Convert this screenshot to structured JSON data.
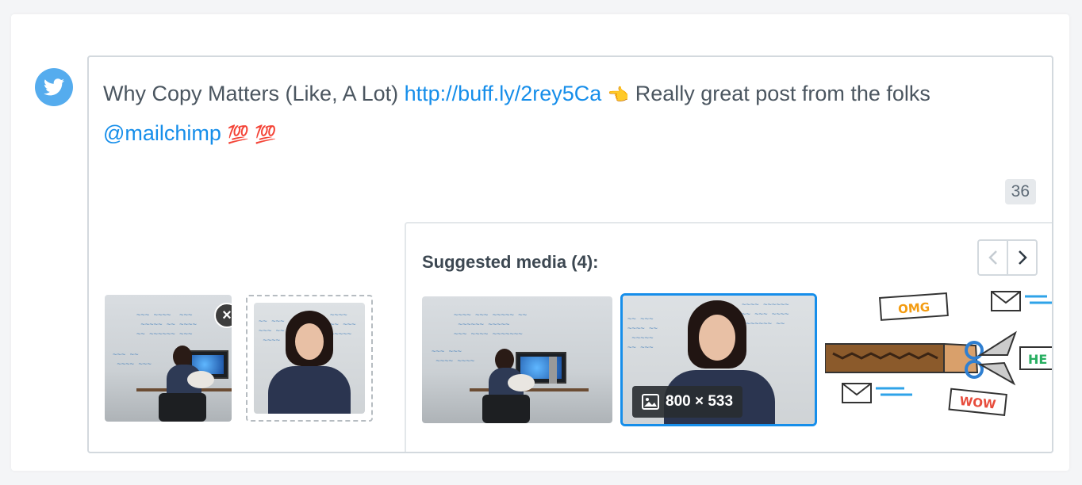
{
  "post": {
    "text_start": "Why Copy Matters (Like, A Lot) ",
    "link": "http://buff.ly/2rey5Ca",
    "text_mid": " Really great post from the folks",
    "mention": "@mailchimp",
    "emoji_point": "👈",
    "emoji_100a": "💯",
    "emoji_100b": "💯",
    "char_count": "36"
  },
  "attached": {
    "remove_label": "×"
  },
  "suggested": {
    "title": "Suggested media (4):",
    "prev_label": "‹",
    "next_label": "›",
    "size_label": "800 × 533"
  },
  "illustration": {
    "tag_omg": "OMG",
    "tag_wow": "WOW",
    "tag_hey": "HE"
  },
  "colors": {
    "twitter": "#55acee",
    "link": "#168eea",
    "selected_border": "#168eea"
  }
}
